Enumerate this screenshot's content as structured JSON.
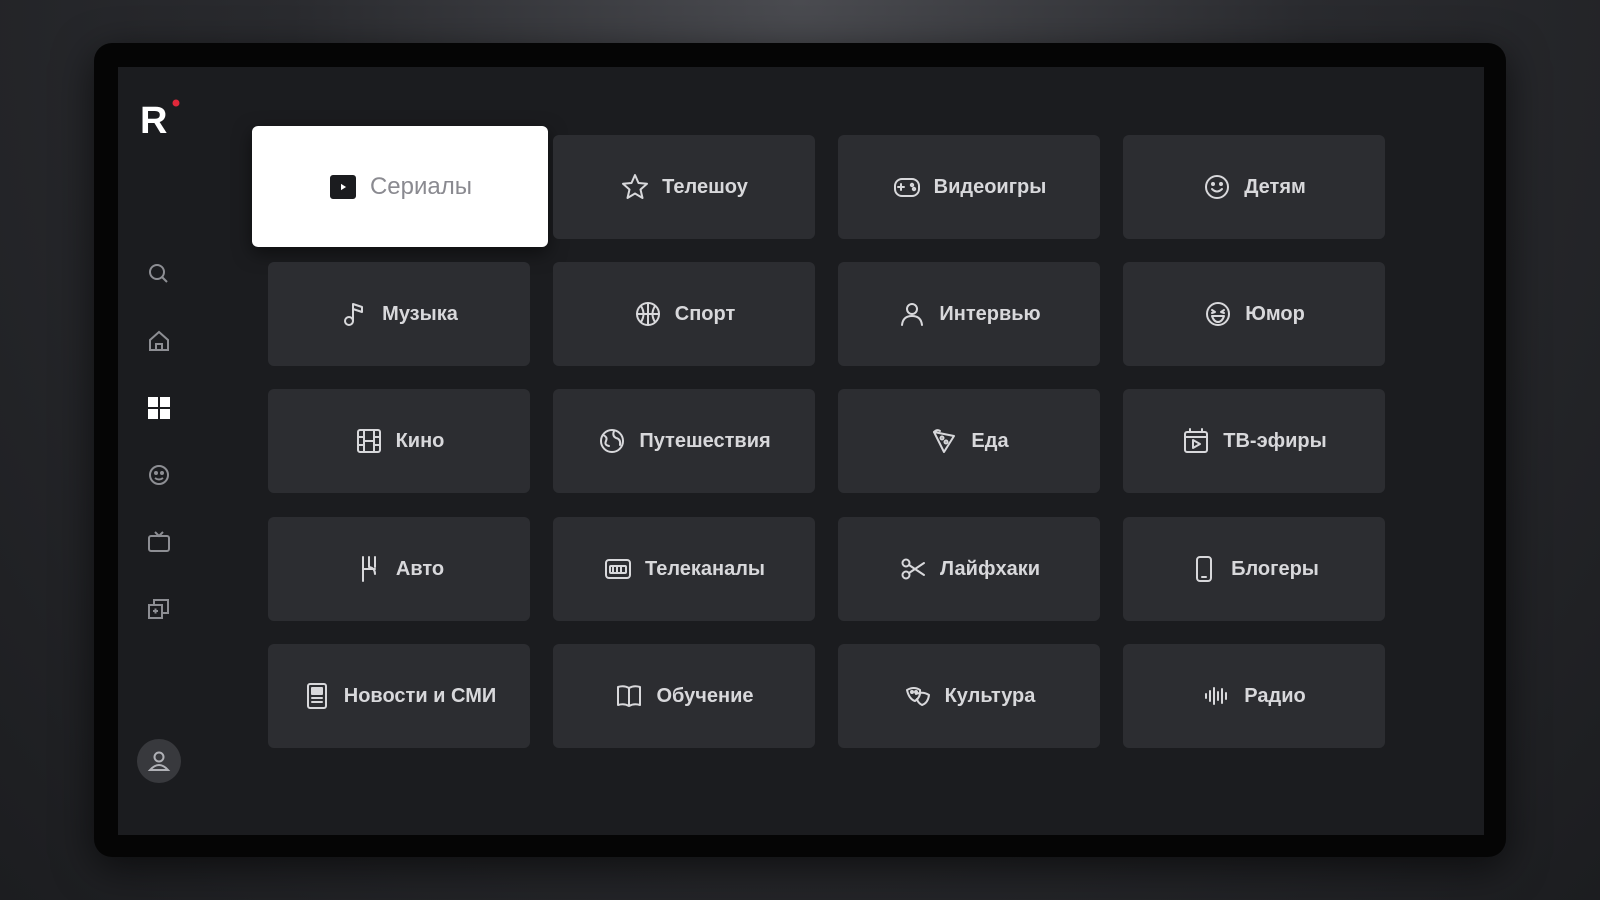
{
  "app": {
    "logo_letter": "R",
    "accent_color": "#e0283a"
  },
  "sidebar": {
    "items": [
      {
        "name": "search-icon",
        "active": false
      },
      {
        "name": "home-icon",
        "active": false
      },
      {
        "name": "categories-icon",
        "active": true
      },
      {
        "name": "kids-icon",
        "active": false
      },
      {
        "name": "tv-icon",
        "active": false
      },
      {
        "name": "collections-icon",
        "active": false
      }
    ],
    "profile_icon": "profile-icon"
  },
  "categories": [
    {
      "label": "Сериалы",
      "icon": "play-icon",
      "focused": true
    },
    {
      "label": "Телешоу",
      "icon": "star-icon"
    },
    {
      "label": "Видеоигры",
      "icon": "gamepad-icon"
    },
    {
      "label": "Детям",
      "icon": "smile-icon"
    },
    {
      "label": "Музыка",
      "icon": "music-note-icon"
    },
    {
      "label": "Спорт",
      "icon": "ball-icon"
    },
    {
      "label": "Интервью",
      "icon": "person-icon"
    },
    {
      "label": "Юмор",
      "icon": "laugh-icon"
    },
    {
      "label": "Кино",
      "icon": "film-icon"
    },
    {
      "label": "Путешествия",
      "icon": "globe-icon"
    },
    {
      "label": "Еда",
      "icon": "food-icon"
    },
    {
      "label": "ТВ-эфиры",
      "icon": "broadcast-icon"
    },
    {
      "label": "Авто",
      "icon": "car-icon"
    },
    {
      "label": "Телеканалы",
      "icon": "channels-icon"
    },
    {
      "label": "Лайфхаки",
      "icon": "scissors-icon"
    },
    {
      "label": "Блогеры",
      "icon": "phone-icon"
    },
    {
      "label": "Новости и СМИ",
      "icon": "newspaper-icon"
    },
    {
      "label": "Обучение",
      "icon": "book-icon"
    },
    {
      "label": "Культура",
      "icon": "masks-icon"
    },
    {
      "label": "Радио",
      "icon": "radio-wave-icon"
    }
  ]
}
